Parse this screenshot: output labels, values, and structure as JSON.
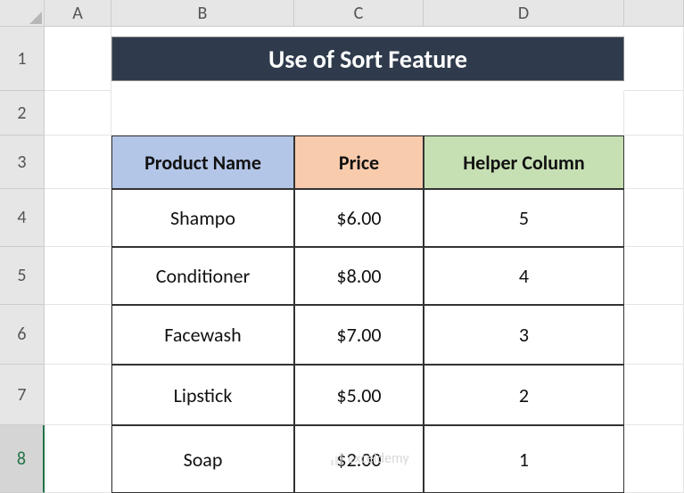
{
  "columns": [
    "A",
    "B",
    "C",
    "D"
  ],
  "rows": [
    "1",
    "2",
    "3",
    "4",
    "5",
    "6",
    "7",
    "8"
  ],
  "active_row_index": 7,
  "title": "Use of Sort Feature",
  "headers": {
    "product": "Product Name",
    "price": "Price",
    "helper": "Helper Column"
  },
  "chart_data": {
    "type": "table",
    "columns": [
      "Product Name",
      "Price",
      "Helper Column"
    ],
    "rows": [
      {
        "product": "Shampo",
        "price": "$6.00",
        "helper": "5"
      },
      {
        "product": "Conditioner",
        "price": "$8.00",
        "helper": "4"
      },
      {
        "product": "Facewash",
        "price": "$7.00",
        "helper": "3"
      },
      {
        "product": "Lipstick",
        "price": "$5.00",
        "helper": "2"
      },
      {
        "product": "Soap",
        "price": "$2.00",
        "helper": "1"
      }
    ]
  },
  "watermark": "exceldemy"
}
